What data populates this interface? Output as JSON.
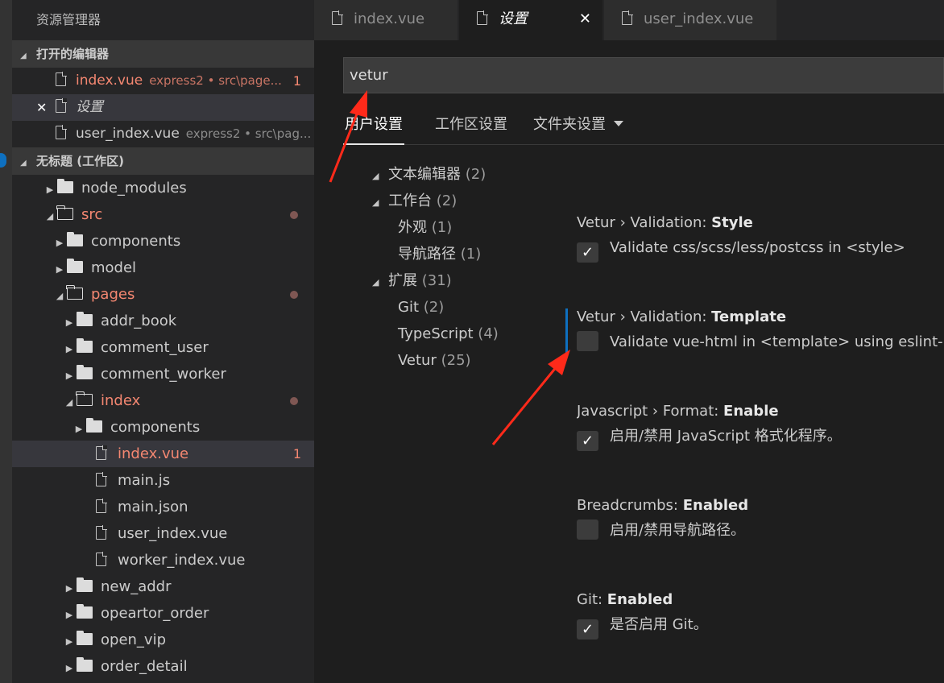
{
  "sidebar": {
    "title": "资源管理器",
    "open_editors": {
      "header": "打开的编辑器",
      "items": [
        {
          "name": "index.vue",
          "desc": "express2 • src\\page...",
          "badge": "1"
        },
        {
          "name": "设置"
        },
        {
          "name": "user_index.vue",
          "desc": "express2 • src\\pag..."
        }
      ]
    },
    "workspace": {
      "header": "无标题 (工作区)",
      "items": [
        {
          "name": "node_modules"
        },
        {
          "name": "src"
        },
        {
          "name": "components"
        },
        {
          "name": "model"
        },
        {
          "name": "pages"
        },
        {
          "name": "addr_book"
        },
        {
          "name": "comment_user"
        },
        {
          "name": "comment_worker"
        },
        {
          "name": "index"
        },
        {
          "name": "components"
        },
        {
          "name": "index.vue",
          "badge": "1"
        },
        {
          "name": "main.js"
        },
        {
          "name": "main.json"
        },
        {
          "name": "user_index.vue"
        },
        {
          "name": "worker_index.vue"
        },
        {
          "name": "new_addr"
        },
        {
          "name": "opeartor_order"
        },
        {
          "name": "open_vip"
        },
        {
          "name": "order_detail"
        }
      ]
    }
  },
  "tabs": [
    {
      "label": "index.vue"
    },
    {
      "label": "设置",
      "close": "✕"
    },
    {
      "label": "user_index.vue"
    }
  ],
  "search": {
    "value": "vetur"
  },
  "settings_tabs": [
    {
      "label": "用户设置"
    },
    {
      "label": "工作区设置"
    },
    {
      "label": "文件夹设置"
    }
  ],
  "toc": [
    {
      "label": "文本编辑器",
      "count": "(2)"
    },
    {
      "label": "工作台",
      "count": "(2)"
    },
    {
      "label": "外观",
      "count": "(1)"
    },
    {
      "label": "导航路径",
      "count": "(1)"
    },
    {
      "label": "扩展",
      "count": "(31)"
    },
    {
      "label": "Git",
      "count": "(2)"
    },
    {
      "label": "TypeScript",
      "count": "(4)"
    },
    {
      "label": "Vetur",
      "count": "(25)"
    }
  ],
  "settings": [
    {
      "prefix": "Vetur › Validation: ",
      "key": "Style",
      "desc": "Validate css/scss/less/postcss in <style>",
      "checked": true
    },
    {
      "prefix": "Vetur › Validation: ",
      "key": "Template",
      "desc": "Validate vue-html in <template> using eslint-plu",
      "checked": false
    },
    {
      "prefix": "Javascript › Format: ",
      "key": "Enable",
      "desc": "启用/禁用 JavaScript 格式化程序。",
      "checked": true
    },
    {
      "prefix": "Breadcrumbs: ",
      "key": "Enabled",
      "desc": "启用/禁用导航路径。",
      "checked": false
    },
    {
      "prefix": "Git: ",
      "key": "Enabled",
      "desc": "是否启用 Git。",
      "checked": true
    }
  ],
  "colors": {
    "accent": "#0e70c0",
    "modified": "#f48771",
    "annotation_arrow": "#ff2a1a"
  }
}
